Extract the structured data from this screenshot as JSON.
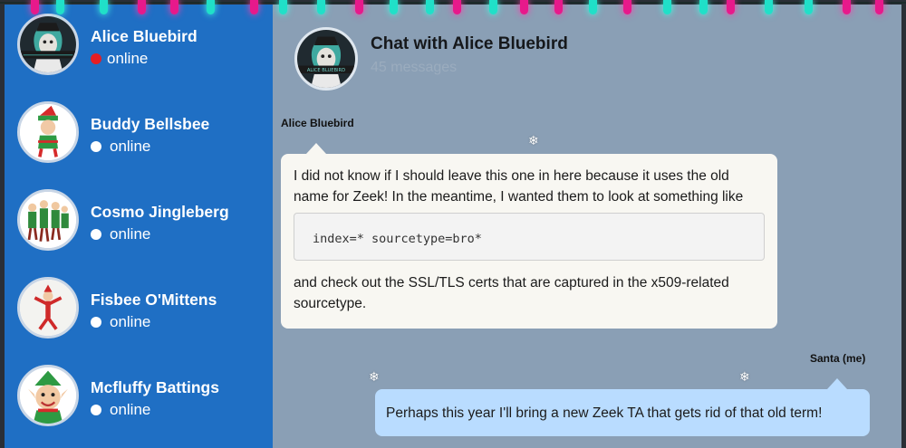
{
  "sidebar": {
    "contacts": [
      {
        "name": "Alice Bluebird",
        "status": "online",
        "status_color": "#e41e24",
        "avatar": "alice-bluebird-avatar"
      },
      {
        "name": "Buddy Bellsbee",
        "status": "online",
        "status_color": "#ffffff",
        "avatar": "elf-avatar"
      },
      {
        "name": "Cosmo Jingleberg",
        "status": "online",
        "status_color": "#ffffff",
        "avatar": "elf-group-avatar"
      },
      {
        "name": "Fisbee O'Mittens",
        "status": "online",
        "status_color": "#ffffff",
        "avatar": "elf-toy-avatar"
      },
      {
        "name": "Mcfluffy Battings",
        "status": "online",
        "status_color": "#ffffff",
        "avatar": "elf-face-avatar"
      }
    ]
  },
  "chat": {
    "title": "Chat with Alice Bluebird",
    "message_count": "45 messages",
    "avatar_text": "ALICE BLUEBIRD",
    "messages": [
      {
        "sender": "Alice Bluebird",
        "text_before": "I did not know if I should leave this one in here because it uses the old name for Zeek! In the meantime, I wanted them to look at something like",
        "code": "index=* sourcetype=bro*",
        "text_after": "and check out the SSL/TLS certs that are captured in the x509-related sourcetype."
      },
      {
        "sender": "Santa (me)",
        "text": "Perhaps this year I'll bring a new Zeek TA that gets rid of that old term!"
      }
    ]
  },
  "decor": {
    "snowflake": "❄"
  },
  "colors": {
    "sidebar": "#1f6fc4",
    "chat_bg": "#8a9fb5",
    "incoming_bubble": "#f8f7f2",
    "outgoing_bubble": "#b9dcff",
    "light_pink": "#e7198b",
    "light_teal": "#20e0c8"
  }
}
